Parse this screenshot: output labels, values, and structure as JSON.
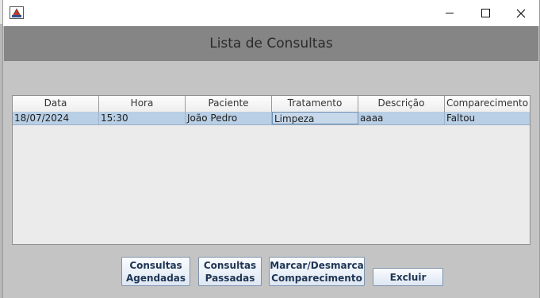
{
  "window": {
    "title": "",
    "header_title": "Lista de Consultas"
  },
  "table": {
    "columns": [
      "Data",
      "Hora",
      "Paciente",
      "Tratamento",
      "Descrição",
      "Comparecimento"
    ],
    "rows": [
      [
        "18/07/2024",
        "15:30",
        "João Pedro",
        "Limpeza",
        "aaaa",
        "Faltou"
      ]
    ]
  },
  "buttons": {
    "consultas_agendadas": [
      "Consultas",
      "Agendadas"
    ],
    "consultas_passadas": [
      "Consultas",
      "Passadas"
    ],
    "marcar_comparecimento": [
      "Marcar/Desmarca",
      "Comparecimento"
    ],
    "excluir": "Excluir"
  },
  "colors": {
    "header_band": "#858585",
    "row_selected": "#b8cfe5",
    "window_bg": "#c4c4c4"
  },
  "icons": {
    "app": "java-app-icon",
    "minimize": "minimize-icon",
    "maximize": "maximize-icon",
    "close": "close-icon"
  }
}
